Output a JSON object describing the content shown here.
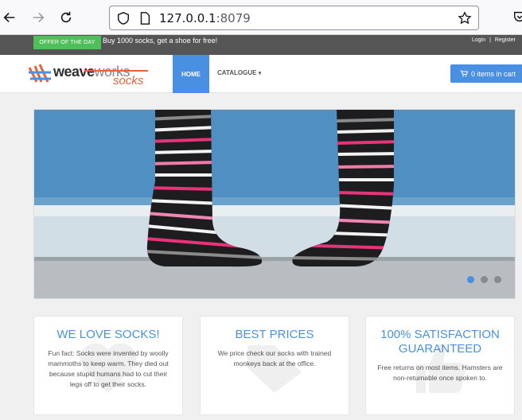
{
  "browser": {
    "url_host": "127.0.0.1",
    "url_port": ":8079"
  },
  "topbar": {
    "offer_badge": "OFFER OF THE DAY",
    "offer_text": "Buy 1000 socks, get a shoe for free!",
    "login": "Login",
    "separator": "|",
    "register": "Register"
  },
  "navbar": {
    "logo_weave": "weave",
    "logo_works": "works",
    "logo_socks": "socks",
    "home": "HOME",
    "catalogue": "CATALOGUE",
    "catalogue_caret": "▾",
    "cart": "0 items in cart"
  },
  "carousel": {
    "slides": 3,
    "active_index": 0
  },
  "features": [
    {
      "title": "WE LOVE SOCKS!",
      "text": "Fun fact: Socks were invented by woolly mammoths to keep warm. They died out because stupid humans had to cut their legs off to get their socks."
    },
    {
      "title": "BEST PRICES",
      "text": "We price check our socks with trained monkeys back at the office."
    },
    {
      "title": "100% SATISFACTION GUARANTEED",
      "text": "Free returns on most items. Hamsters are non-returnable once spoken to."
    }
  ],
  "colors": {
    "accent": "#4a90e2",
    "offer": "#4fbf5a",
    "brand_orange": "#e8613c"
  }
}
